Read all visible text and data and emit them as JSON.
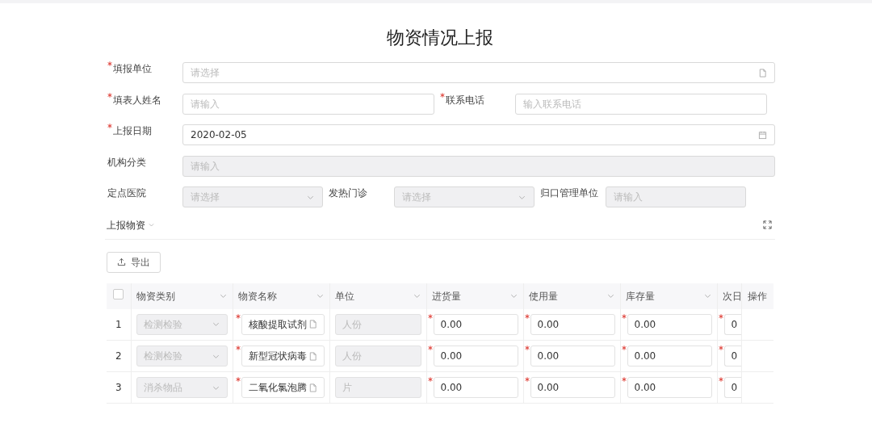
{
  "title": "物资情况上报",
  "form_rows": [
    [
      {
        "label": "填报单位",
        "required": true,
        "kind": "picker",
        "placeholder": "请选择",
        "disabled": false
      }
    ],
    [
      {
        "label": "填表人姓名",
        "required": true,
        "kind": "input",
        "placeholder": "请输入",
        "disabled": false
      },
      {
        "label": "联系电话",
        "required": true,
        "kind": "input",
        "placeholder": "输入联系电话",
        "disabled": false
      }
    ],
    [
      {
        "label": "上报日期",
        "required": true,
        "kind": "date",
        "value": "2020-02-05",
        "disabled": false
      }
    ],
    [
      {
        "label": "机构分类",
        "required": false,
        "kind": "input",
        "placeholder": "请输入",
        "disabled": true
      }
    ],
    [
      {
        "label": "定点医院",
        "required": false,
        "kind": "dropdown",
        "placeholder": "请选择",
        "disabled": true
      },
      {
        "label": "发热门诊",
        "required": false,
        "kind": "dropdown",
        "placeholder": "请选择",
        "disabled": true
      },
      {
        "label": "归口管理单位",
        "required": false,
        "kind": "input",
        "placeholder": "请输入",
        "disabled": true
      }
    ]
  ],
  "section": {
    "title": "上报物资",
    "expanded": true
  },
  "export_button": "导出",
  "table": {
    "select_all_checked": false,
    "columns": [
      {
        "label": "物资类别",
        "filter": true,
        "required": false
      },
      {
        "label": "物资名称",
        "filter": true,
        "required": true
      },
      {
        "label": "单位",
        "filter": true,
        "required": false
      },
      {
        "label": "进货量",
        "filter": true,
        "required": true
      },
      {
        "label": "使用量",
        "filter": true,
        "required": true
      },
      {
        "label": "库存量",
        "filter": true,
        "required": true
      },
      {
        "label": "次日",
        "filter": false,
        "required": true
      },
      {
        "label": "操作",
        "filter": false,
        "required": false
      }
    ],
    "rows": [
      {
        "index": "1",
        "category": "检测检验",
        "name": "核酸提取试剂",
        "unit": "人份",
        "received": "0.00",
        "used": "0.00",
        "stock": "0.00",
        "next_day": "0"
      },
      {
        "index": "2",
        "category": "检测检验",
        "name": "新型冠状病毒",
        "unit": "人份",
        "received": "0.00",
        "used": "0.00",
        "stock": "0.00",
        "next_day": "0"
      },
      {
        "index": "3",
        "category": "消杀物品",
        "name": "二氧化氯泡腾",
        "unit": "片",
        "received": "0.00",
        "used": "0.00",
        "stock": "0.00",
        "next_day": "0"
      }
    ]
  }
}
